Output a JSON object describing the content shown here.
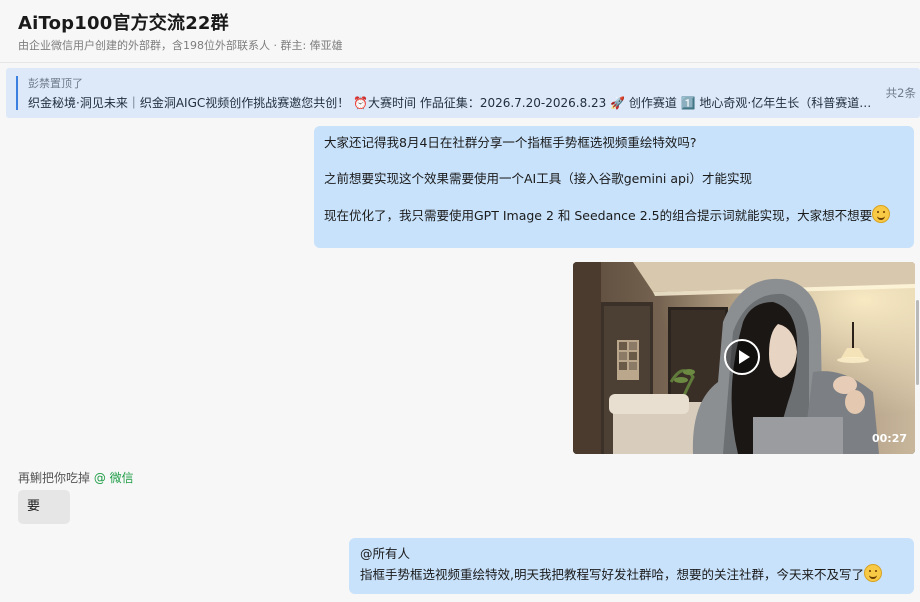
{
  "header": {
    "title": "AiTop100官方交流22群",
    "subtitle": "由企业微信用户创建的外部群，含198位外部联系人 · 群主: 俸亚雄"
  },
  "pinned": {
    "pinned_by": "彭禁置顶了",
    "text": "织金秘境·洞见未来｜织金洞AIGC视频创作挑战赛邀您共创！ ⏰大赛时间 作品征集：2026.7.20-2026.8.23 🚀 创作赛道 1️⃣ 地心奇观·亿年生长（科普赛道…",
    "count": "共2条"
  },
  "messages": {
    "m1": {
      "line1": "大家还记得我8月4日在社群分享一个指框手势框选视频重绘特效吗?",
      "line2": "之前想要实现这个效果需要使用一个AI工具（接入谷歌gemini api）才能实现",
      "line3": "现在优化了，我只需要使用GPT Image 2 和 Seedance 2.5的组合提示词就能实现，大家想不想要",
      "emoji": "grimacing-face"
    },
    "video": {
      "duration": "00:27"
    },
    "m2": {
      "sender": "再鯏把你吃掉",
      "source": "@ 微信",
      "text": "要"
    },
    "m3": {
      "line1": "@所有人",
      "line2": "指框手势框选视频重绘特效,明天我把教程写好发社群哈，想要的关注社群，今天来不及写了",
      "emoji": "winking-face"
    }
  },
  "colors": {
    "self_bubble": "#c8e2fb",
    "other_bubble": "#e6e6e6",
    "pinned_bg": "#dde9f9",
    "accent": "#3b7fe0",
    "source_green": "#1f9d46"
  }
}
